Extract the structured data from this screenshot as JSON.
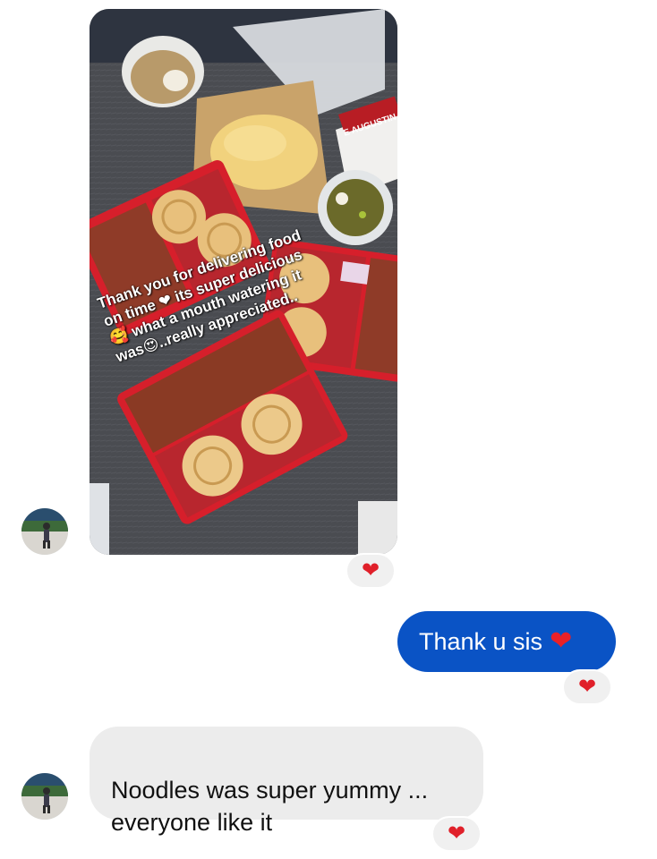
{
  "colors": {
    "outgoing_bubble": "#0a53c5",
    "incoming_bubble": "#ececec",
    "reaction_pill": "#f0f0f0",
    "heart": "#e0202a"
  },
  "messages": [
    {
      "type": "photo",
      "sender": "contact",
      "image_description_icon": "food-delivery-photo",
      "overlay_text": "Thank you for delivering food\non time ❤ its super delicious\n🥰 what a mouth watering it\nwas😍..really appreciated..",
      "label_on_box": "E AUGUSTIN",
      "reaction": "❤"
    },
    {
      "type": "text",
      "sender": "me",
      "text": "Thank u sis",
      "emoji": "❤",
      "reaction": "❤"
    },
    {
      "type": "text",
      "sender": "contact",
      "text": "Noodles was super yummy ...\neveryone like it",
      "reaction": "❤"
    }
  ]
}
